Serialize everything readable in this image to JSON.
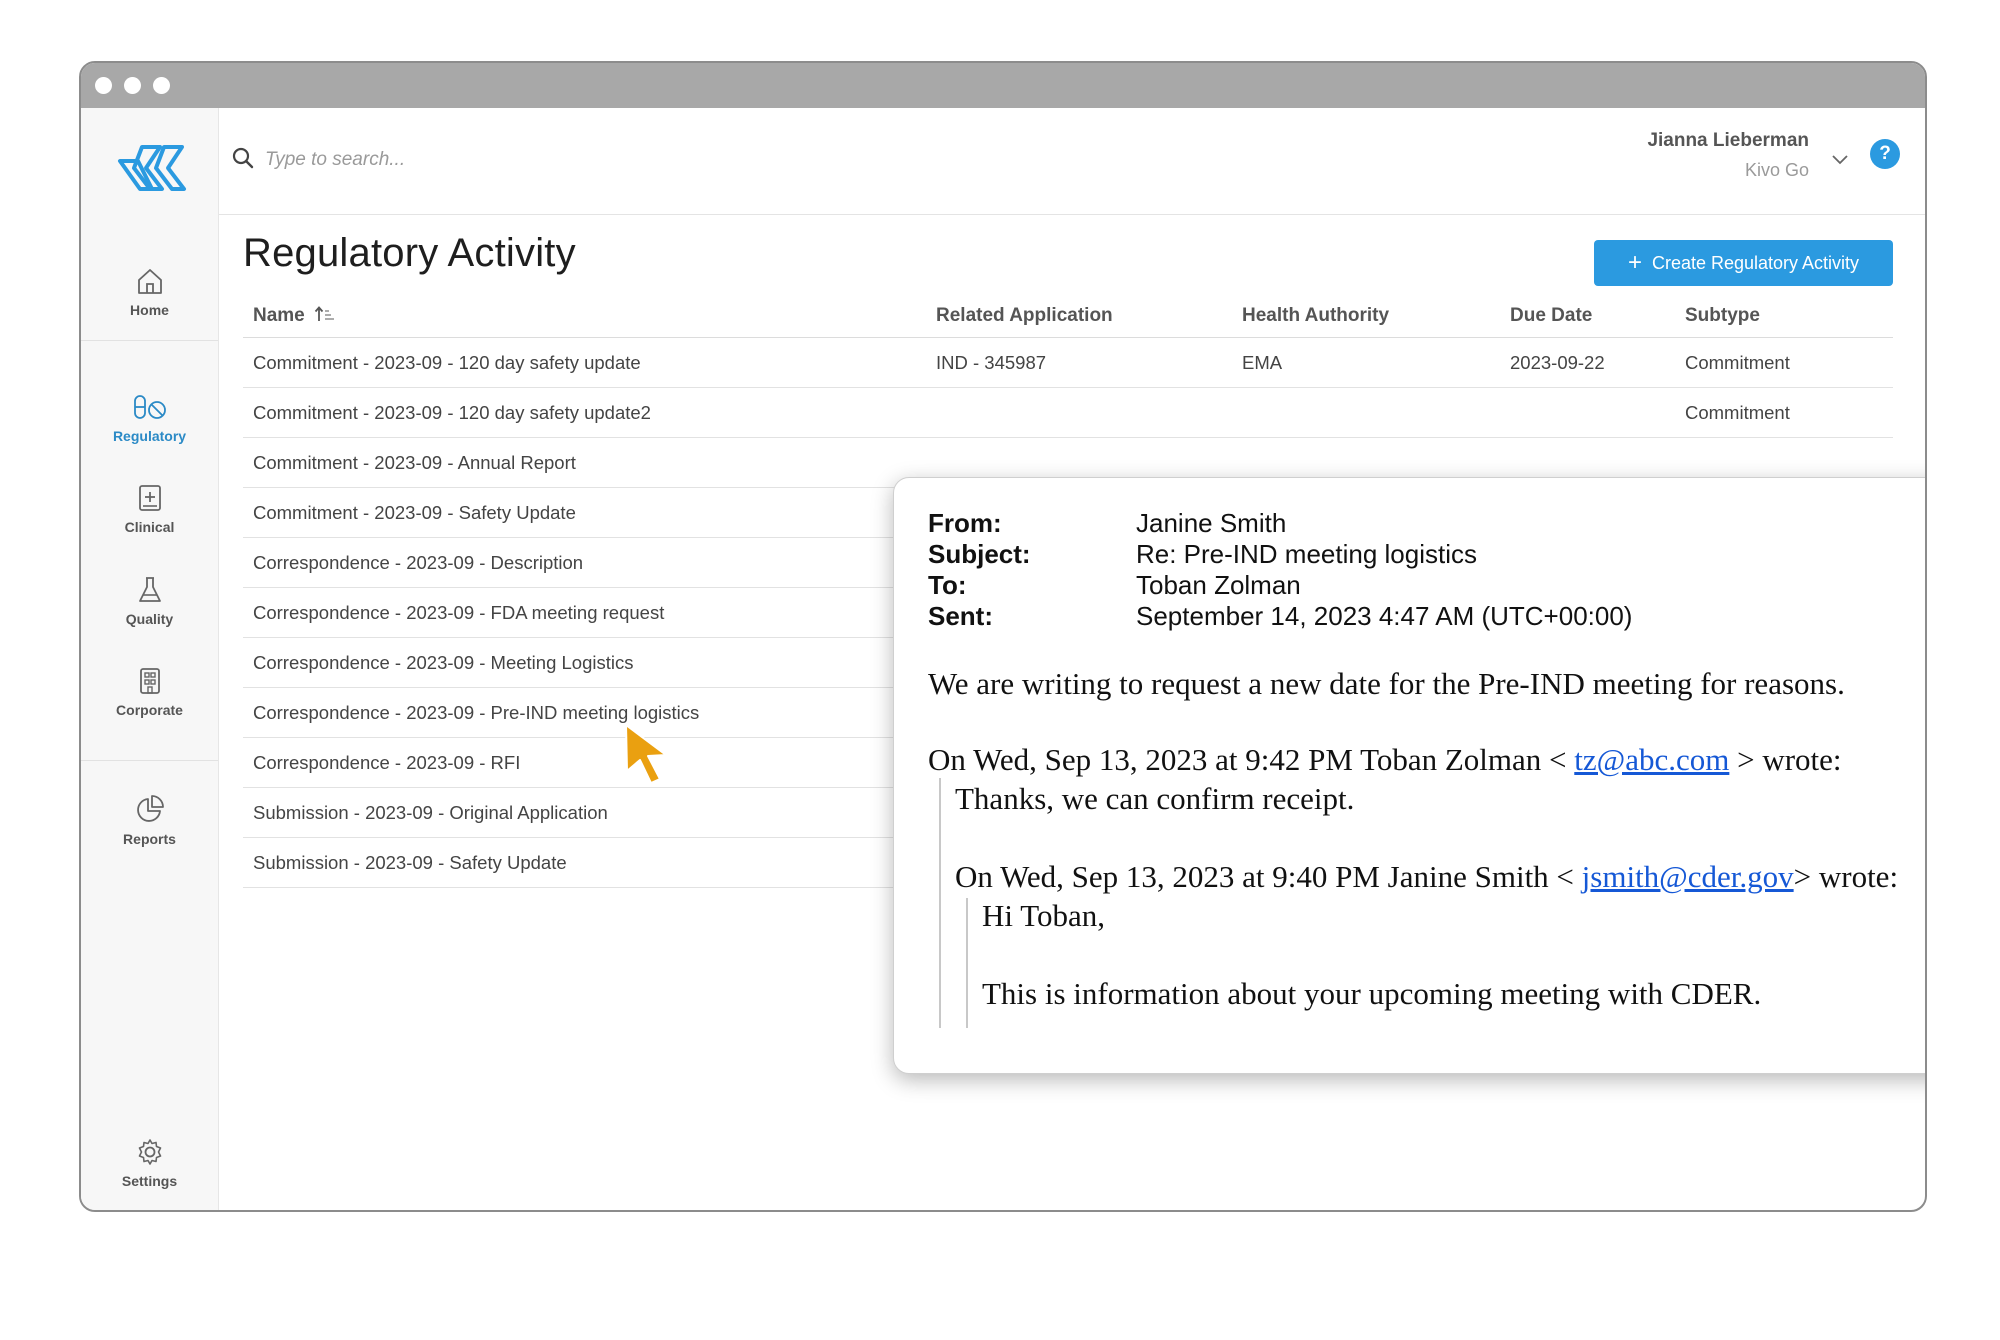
{
  "app": {
    "nav": [
      {
        "label": "Home",
        "icon": "home-icon"
      },
      {
        "label": "Regulatory",
        "icon": "regulatory-icon",
        "active": true
      },
      {
        "label": "Clinical",
        "icon": "clinical-icon"
      },
      {
        "label": "Quality",
        "icon": "flask-icon"
      },
      {
        "label": "Corporate",
        "icon": "building-icon"
      },
      {
        "label": "Reports",
        "icon": "pie-chart-icon"
      },
      {
        "label": "Settings",
        "icon": "gear-icon"
      }
    ],
    "accent_color": "#2b9ae0"
  },
  "search": {
    "placeholder": "Type to search..."
  },
  "user": {
    "name": "Jianna Lieberman",
    "org": "Kivo Go",
    "help": "?"
  },
  "page": {
    "title": "Regulatory Activity",
    "create_label": "Create Regulatory Activity"
  },
  "table": {
    "headers": [
      "Name",
      "Related Application",
      "Health Authority",
      "Due Date",
      "Subtype"
    ],
    "rows": [
      [
        "Commitment - 2023-09 - 120 day safety update",
        "IND - 345987",
        "EMA",
        "2023-09-22",
        "Commitment"
      ],
      [
        "Commitment - 2023-09 - 120 day safety update2",
        "",
        "",
        "",
        "Commitment"
      ],
      [
        "Commitment - 2023-09 - Annual Report",
        "",
        "",
        "",
        ""
      ],
      [
        "Commitment - 2023-09 - Safety Update",
        "",
        "",
        "",
        ""
      ],
      [
        "Correspondence - 2023-09 - Description",
        "",
        "",
        "",
        ""
      ],
      [
        "Correspondence - 2023-09 - FDA meeting request",
        "",
        "",
        "",
        ""
      ],
      [
        "Correspondence - 2023-09 - Meeting Logistics",
        "",
        "",
        "",
        ""
      ],
      [
        "Correspondence - 2023-09 - Pre-IND meeting logistics",
        "",
        "",
        "",
        ""
      ],
      [
        "Correspondence - 2023-09 - RFI",
        "",
        "",
        "",
        ""
      ],
      [
        "Submission - 2023-09 - Original Application",
        "",
        "",
        "",
        ""
      ],
      [
        "Submission - 2023-09 - Safety Update",
        "",
        "",
        "",
        ""
      ]
    ]
  },
  "email": {
    "from_label": "From:",
    "from": "Janine Smith",
    "subject_label": "Subject:",
    "subject": "Re: Pre-IND meeting logistics",
    "to_label": "To:",
    "to": "Toban Zolman",
    "sent_label": "Sent:",
    "sent": "September 14, 2023 4:47 AM (UTC+00:00)",
    "body": "We are writing to request a new date for the Pre-IND meeting for reasons.",
    "quote1_prefix": "On Wed, Sep 13, 2023 at 9:42 PM Toban Zolman < ",
    "quote1_email": "tz@abc.com",
    "quote1_suffix": " > wrote:",
    "quote1_body": "Thanks, we can confirm receipt.",
    "quote2_prefix": "On Wed, Sep 13, 2023 at 9:40 PM  Janine Smith  < ",
    "quote2_email": "jsmith@cder.gov",
    "quote2_suffix": "> wrote:",
    "quote2_greeting": "Hi Toban,",
    "quote2_body": "This is information about your upcoming meeting with CDER."
  }
}
